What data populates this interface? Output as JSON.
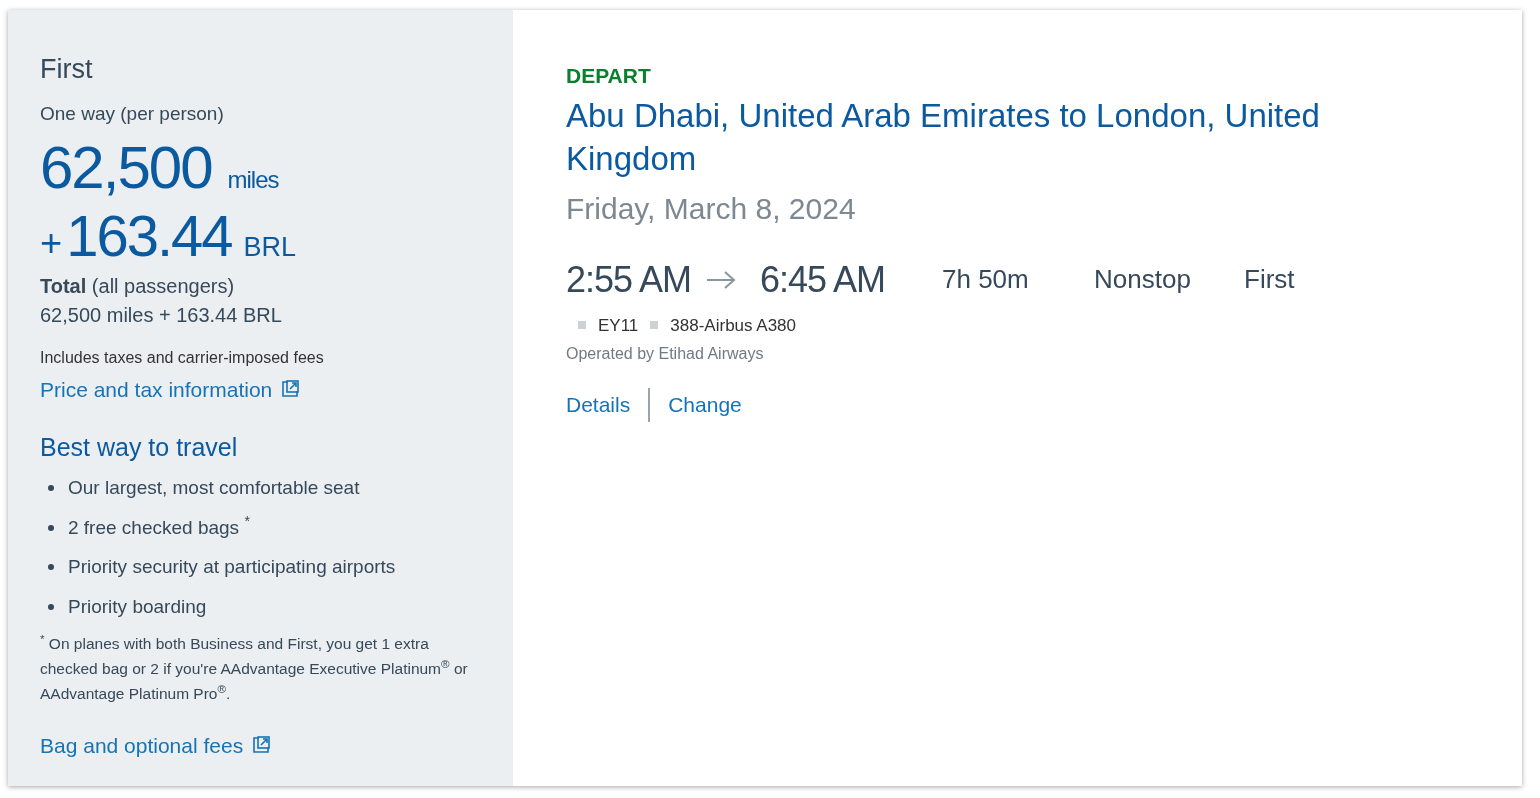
{
  "fare": {
    "cabin": "First",
    "trip_type": "One way (per person)",
    "miles": "62,500",
    "miles_unit": "miles",
    "plus": "+",
    "cash": "163.44",
    "currency": "BRL",
    "total_label": "Total",
    "total_note": "(all passengers)",
    "total_value": "62,500 miles + 163.44 BRL",
    "taxes_note": "Includes taxes and carrier-imposed fees",
    "price_link": "Price and tax information"
  },
  "benefits": {
    "title": "Best way to travel",
    "items": [
      {
        "text": "Our largest, most comfortable seat"
      },
      {
        "text": "2 free checked bags $^{*}$"
      },
      {
        "text": "Priority security at participating airports"
      },
      {
        "text": "Priority boarding"
      }
    ],
    "footnote": "$^{*}$ On planes with both Business and First, you get 1 extra checked bag or 2 if you're AAdvantage Executive Platinum$^{®}$ or AAdvantage Platinum Pro$^{®}$.",
    "bag_link": "Bag and optional fees"
  },
  "flight": {
    "label": "DEPART",
    "route": "Abu Dhabi, United Arab Emirates to London, United Kingdom",
    "date": "Friday, March 8, 2024",
    "depart_time": "2:55 AM",
    "arrive_time": "6:45 AM",
    "duration": "7h 50m",
    "stops": "Nonstop",
    "cabin": "First",
    "flight_number": "EY11",
    "aircraft": "388-Airbus A380",
    "operated_by": "Operated by Etihad Airways",
    "links": [
      "Details",
      "Change"
    ]
  }
}
